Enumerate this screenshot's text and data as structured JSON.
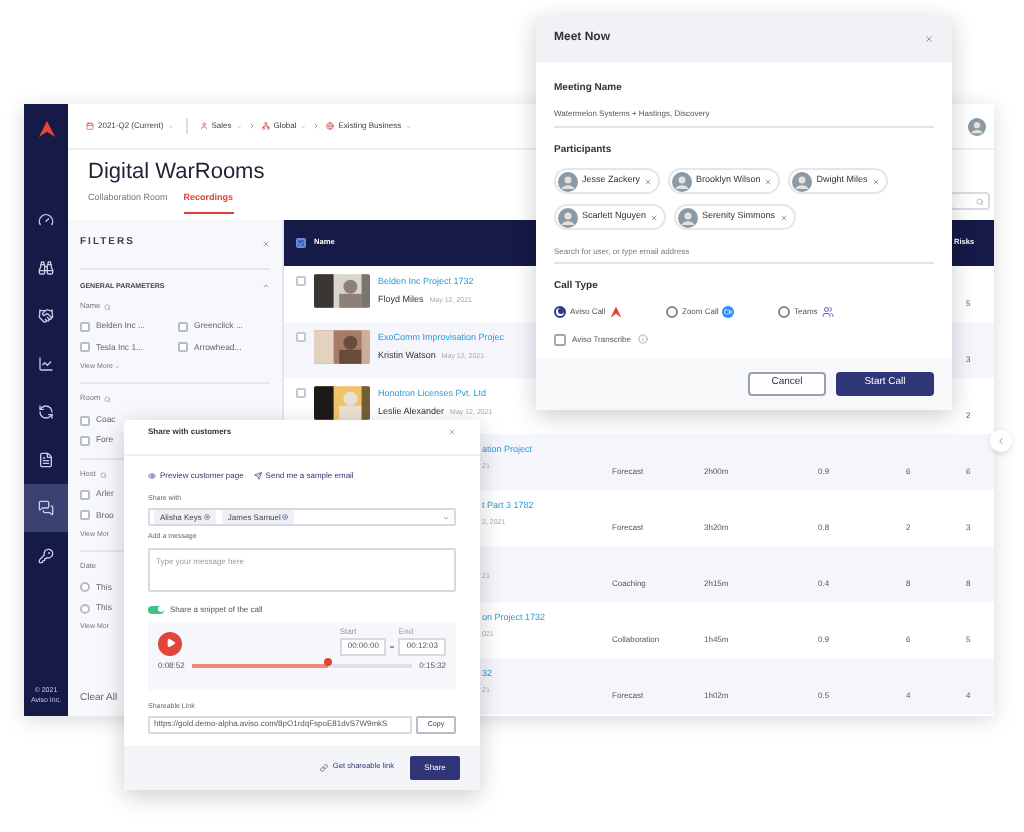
{
  "sidebar": {
    "items": [
      {
        "selected": false
      },
      {
        "selected": false
      },
      {
        "selected": false
      },
      {
        "selected": false
      },
      {
        "selected": false
      },
      {
        "selected": false
      },
      {
        "selected": true
      },
      {
        "selected": false
      }
    ],
    "footer": [
      "© 2021",
      "Aviso Inc."
    ]
  },
  "breadcrumbs": [
    {
      "label": "2021-Q2 (Current)"
    },
    {
      "label": "Sales"
    },
    {
      "label": "Global"
    },
    {
      "label": "Existing Business"
    }
  ],
  "title": "Digital WarRooms",
  "tabs": [
    {
      "label": "Collaboration Room",
      "selected": false
    },
    {
      "label": "Recordings",
      "selected": true
    }
  ],
  "filters": {
    "title": "FILTERS",
    "section": "GENERAL PARAMETERS",
    "groups": [
      {
        "label": "Name",
        "searchable": true,
        "kind": "checkbox",
        "options": [
          {
            "label": "Belden Inc ...",
            "checked": false
          },
          {
            "label": "Greenclick ...",
            "checked": false
          },
          {
            "label": "Tesla Inc 1...",
            "checked": false
          },
          {
            "label": "Arrowhead...",
            "checked": false
          }
        ],
        "more": "View More"
      },
      {
        "label": "Room",
        "searchable": true,
        "kind": "checkbox",
        "options": [
          {
            "label": "Coac",
            "checked": false
          },
          {
            "label": "Fore",
            "checked": false
          }
        ]
      },
      {
        "label": "Host",
        "searchable": true,
        "kind": "checkbox",
        "options": [
          {
            "label": "Arler",
            "checked": false
          },
          {
            "label": "Broo",
            "checked": false
          }
        ],
        "more": "View Mor"
      },
      {
        "label": "Date",
        "searchable": false,
        "kind": "radio",
        "options": [
          {
            "label": "This",
            "checked": false
          },
          {
            "label": "This",
            "checked": false
          }
        ],
        "more": "View Mor"
      }
    ],
    "clear_all": "Clear All"
  },
  "table": {
    "columns": [
      "Name",
      "Risks"
    ],
    "all_checked": true,
    "rows": [
      {
        "kind": "full",
        "checked": false,
        "name": "Belden Inc Project 1732",
        "host": "Floyd Miles",
        "date": "May 12, 2021",
        "risks": "5"
      },
      {
        "kind": "full",
        "checked": false,
        "name": "ExoComm Improvisation Projec",
        "host": "Kristin Watson",
        "date": "May 12, 2021",
        "risks": "3"
      },
      {
        "kind": "full",
        "checked": false,
        "name": "Honotron Licenses Pvt. Ltd",
        "host": "Leslie Alexander",
        "date": "May 12, 2021",
        "risks": "2"
      },
      {
        "kind": "partial",
        "name": "ation Project",
        "date": "21",
        "type": "Forecast",
        "duration": "2h00m",
        "score": "0.9",
        "column_5": "6",
        "risks": "6"
      },
      {
        "kind": "partial",
        "name": "t Part 3 1782",
        "date": "2, 2021",
        "type": "Forecast",
        "duration": "3h20m",
        "score": "0.8",
        "column_5": "2",
        "risks": "3"
      },
      {
        "kind": "partial",
        "date": "21",
        "type": "Coaching",
        "duration": "2h15m",
        "score": "0.4",
        "column_5": "8",
        "risks": "8"
      },
      {
        "kind": "partial",
        "name": "on Project 1732",
        "date": "021",
        "type": "Collaboration",
        "duration": "1h45m",
        "score": "0.9",
        "column_5": "6",
        "risks": "5"
      },
      {
        "kind": "partial",
        "name": "32",
        "date": "21",
        "type": "Forecast",
        "duration": "1h02m",
        "score": "0.5",
        "column_5": "4",
        "risks": "4"
      }
    ]
  },
  "meet_now": {
    "title": "Meet Now",
    "meeting_name_label": "Meeting Name",
    "meeting_name": "Watermelon Systems + Hastings, Discovery",
    "participants_label": "Participants",
    "participants": [
      "Jesse Zackery",
      "Brooklyn Wilson",
      "Dwight Miles",
      "Scarlett Nguyen",
      "Serenity Simmons"
    ],
    "search_placeholder": "Search for user, or type email address",
    "call_type_label": "Call Type",
    "call_types": [
      {
        "label": "Aviso Call",
        "kind": "aviso",
        "selected": true
      },
      {
        "label": "Zoom Call",
        "kind": "zoom",
        "selected": false
      },
      {
        "label": "Teams",
        "kind": "teams",
        "selected": false
      }
    ],
    "transcribe": {
      "label": "Aviso Transcribe",
      "checked": false
    },
    "buttons": {
      "cancel": "Cancel",
      "start": "Start Call"
    }
  },
  "share": {
    "title": "Share with customers",
    "links": [
      "Preview customer page",
      "Send me a sample email"
    ],
    "share_with_label": "Share with",
    "recipients": [
      "Alisha Keys",
      "James Samuel"
    ],
    "message_label": "Add a message",
    "message_placeholder": "Type your message here",
    "snippet": {
      "on": true,
      "label": "Share a snippet of the call"
    },
    "player": {
      "start_label": "Start",
      "start": "00:00:00",
      "end_label": "End",
      "end": "00:12:03",
      "current": "0:08:52",
      "total": "0:15:32",
      "level": 0.62
    },
    "link_label": "Shareable Link",
    "link": "https://gold.demo-alpha.aviso.com/8pO1rdqFspoE81dvS7W9mkS",
    "copy": "Copy",
    "get_link": "Get shareable link",
    "share_button": "Share"
  }
}
